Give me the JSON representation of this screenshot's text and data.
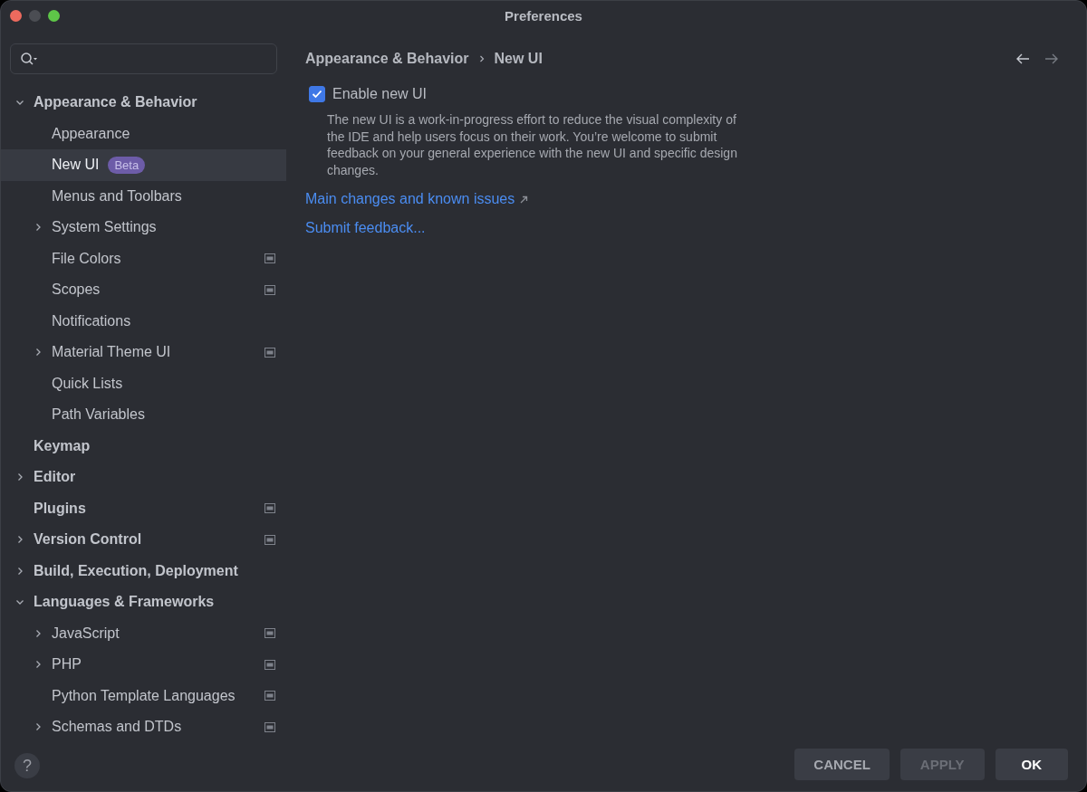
{
  "window": {
    "title": "Preferences"
  },
  "sidebar": {
    "items": [
      {
        "label": "Appearance & Behavior",
        "expanded": true,
        "selected": false,
        "project_level": false,
        "children": [
          {
            "label": "Appearance",
            "selected": false,
            "project_level": false
          },
          {
            "label": "New UI",
            "selected": true,
            "project_level": false,
            "badge": "Beta"
          },
          {
            "label": "Menus and Toolbars",
            "selected": false,
            "project_level": false
          },
          {
            "label": "System Settings",
            "expanded": false,
            "selected": false,
            "project_level": false
          },
          {
            "label": "File Colors",
            "selected": false,
            "project_level": true
          },
          {
            "label": "Scopes",
            "selected": false,
            "project_level": true
          },
          {
            "label": "Notifications",
            "selected": false,
            "project_level": false
          },
          {
            "label": "Material Theme UI",
            "expanded": false,
            "selected": false,
            "project_level": true
          },
          {
            "label": "Quick Lists",
            "selected": false,
            "project_level": false
          },
          {
            "label": "Path Variables",
            "selected": false,
            "project_level": false
          }
        ]
      },
      {
        "label": "Keymap",
        "selected": false,
        "project_level": false
      },
      {
        "label": "Editor",
        "expanded": false,
        "selected": false,
        "project_level": false
      },
      {
        "label": "Plugins",
        "selected": false,
        "project_level": true
      },
      {
        "label": "Version Control",
        "expanded": false,
        "selected": false,
        "project_level": true
      },
      {
        "label": "Build, Execution, Deployment",
        "expanded": false,
        "selected": false,
        "project_level": false
      },
      {
        "label": "Languages & Frameworks",
        "expanded": true,
        "selected": false,
        "project_level": false,
        "children": [
          {
            "label": "JavaScript",
            "expanded": false,
            "selected": false,
            "project_level": true
          },
          {
            "label": "PHP",
            "expanded": false,
            "selected": false,
            "project_level": true
          },
          {
            "label": "Python Template Languages",
            "selected": false,
            "project_level": true
          },
          {
            "label": "Schemas and DTDs",
            "expanded": false,
            "selected": false,
            "project_level": true
          }
        ]
      }
    ]
  },
  "breadcrumb": [
    "Appearance & Behavior",
    "New UI"
  ],
  "content": {
    "checkbox": {
      "label": "Enable new UI",
      "checked": true
    },
    "description": "The new UI is a work-in-progress effort to reduce the visual complexity of the IDE and help users focus on their work. You’re welcome to submit feedback on your general experience with the new UI and specific design changes.",
    "links": [
      {
        "label": "Main changes and known issues",
        "external": true
      },
      {
        "label": "Submit feedback...",
        "external": false
      }
    ]
  },
  "help": {
    "label": "?"
  },
  "buttons": [
    {
      "label": "CANCEL",
      "disabled": false,
      "default": false
    },
    {
      "label": "APPLY",
      "disabled": true,
      "default": false
    },
    {
      "label": "OK",
      "disabled": false,
      "default": true
    }
  ]
}
